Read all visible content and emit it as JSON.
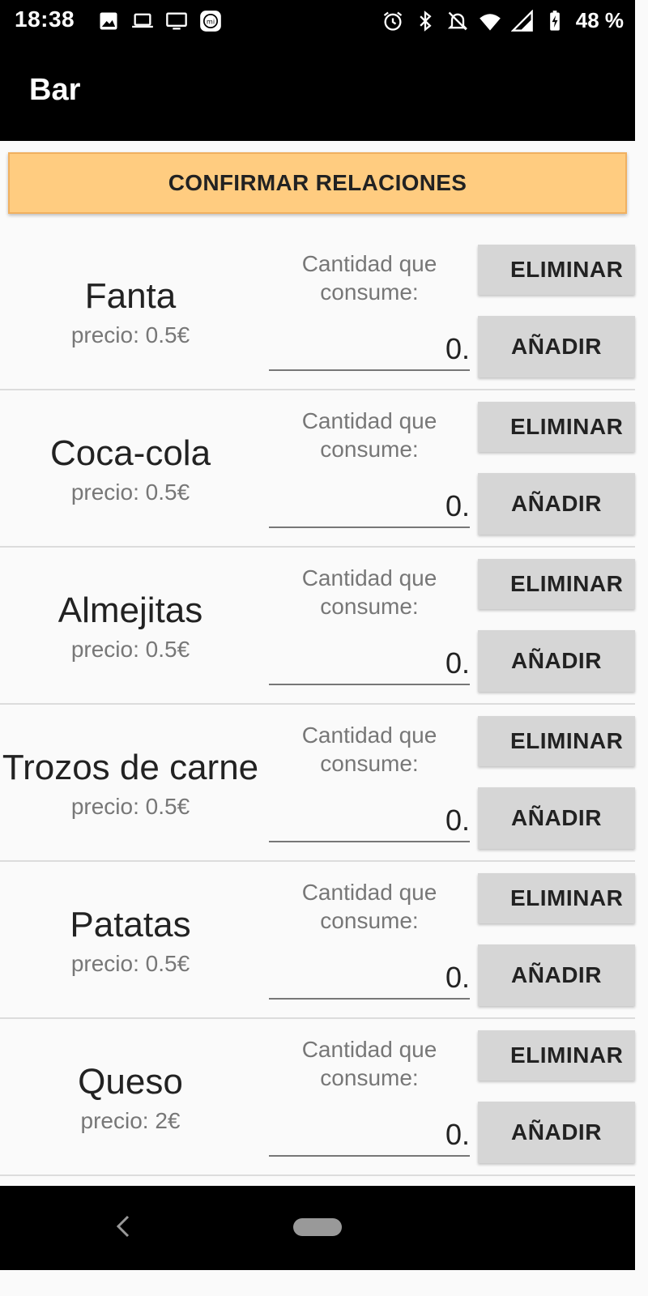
{
  "status_bar": {
    "time": "18:38",
    "battery": "48 %",
    "icons_left": [
      "image-icon",
      "laptop-icon",
      "cast-icon",
      "mi-icon"
    ],
    "icons_right": [
      "alarm-icon",
      "bluetooth-icon",
      "notifications-off-icon",
      "wifi-icon",
      "signal-icon",
      "battery-icon"
    ]
  },
  "app_bar": {
    "title": "Bar"
  },
  "confirm_button": {
    "label": "CONFIRMAR RELACIONES"
  },
  "items": [
    {
      "name": "Fanta",
      "price": "precio: 0.5€",
      "qty_label": "Cantidad que consume:",
      "qty_value": "0.",
      "delete_label": "ELIMINAR",
      "add_label": "AÑADIR"
    },
    {
      "name": "Coca-cola",
      "price": "precio: 0.5€",
      "qty_label": "Cantidad que consume:",
      "qty_value": "0.",
      "delete_label": "ELIMINAR",
      "add_label": "AÑADIR"
    },
    {
      "name": "Almejitas",
      "price": "precio: 0.5€",
      "qty_label": "Cantidad que consume:",
      "qty_value": "0.",
      "delete_label": "ELIMINAR",
      "add_label": "AÑADIR"
    },
    {
      "name": "Trozos de carne",
      "price": "precio: 0.5€",
      "qty_label": "Cantidad que consume:",
      "qty_value": "0.",
      "delete_label": "ELIMINAR",
      "add_label": "AÑADIR"
    },
    {
      "name": "Patatas",
      "price": "precio: 0.5€",
      "qty_label": "Cantidad que consume:",
      "qty_value": "0.",
      "delete_label": "ELIMINAR",
      "add_label": "AÑADIR"
    },
    {
      "name": "Queso",
      "price": "precio: 2€",
      "qty_label": "Cantidad que consume:",
      "qty_value": "0.",
      "delete_label": "ELIMINAR",
      "add_label": "AÑADIR"
    }
  ],
  "nav_bar": {
    "icons": [
      "back-icon",
      "home-pill-icon"
    ]
  },
  "colors": {
    "bar_background": "#000000",
    "confirm_button": "#ffcc80",
    "gray_button": "#d6d6d6",
    "page_background": "#fafafa"
  }
}
